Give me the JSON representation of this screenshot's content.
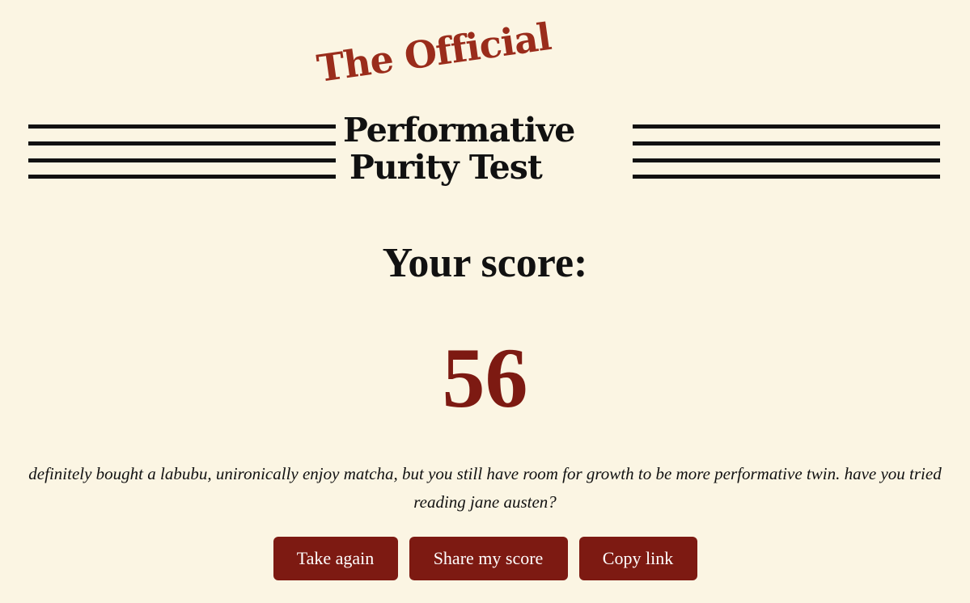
{
  "header": {
    "kicker": "The Official",
    "title_line1": "Performative",
    "title_line2": "Purity Test"
  },
  "result": {
    "label": "Your score:",
    "score": "56",
    "message": "definitely bought a labubu, unironically enjoy matcha, but you still have room for growth to be more performative twin. have you tried reading jane austen?"
  },
  "actions": {
    "take_again": "Take again",
    "share": "Share my score",
    "copy_link": "Copy link"
  },
  "colors": {
    "background": "#fbf5e3",
    "accent": "#7d1a12",
    "kicker": "#9a2c1b",
    "text": "#111111"
  }
}
